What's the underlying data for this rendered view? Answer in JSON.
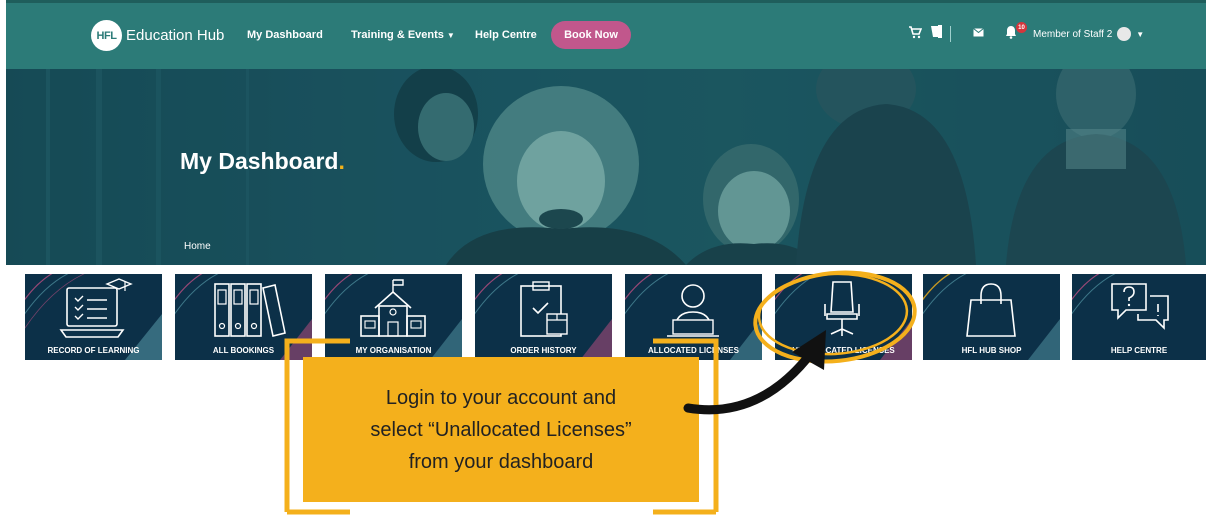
{
  "nav": {
    "logo_badge": "HFL",
    "logo_text": "Education Hub",
    "links": [
      {
        "label": "My Dashboard"
      },
      {
        "label": "Training & Events"
      },
      {
        "label": "Help Centre"
      }
    ],
    "book_now": "Book Now",
    "notification_count": "10",
    "user_name": "Member of Staff 2"
  },
  "hero": {
    "title": "My Dashboard",
    "title_dot": ".",
    "breadcrumb": "Home"
  },
  "tiles": [
    {
      "label": "RECORD OF LEARNING",
      "icon": "laptop-graduation-cap-icon"
    },
    {
      "label": "ALL BOOKINGS",
      "icon": "binders-icon"
    },
    {
      "label": "MY ORGANISATION",
      "icon": "school-building-icon"
    },
    {
      "label": "ORDER HISTORY",
      "icon": "clipboard-box-icon"
    },
    {
      "label": "ALLOCATED LICENSES",
      "icon": "person-laptop-icon"
    },
    {
      "label": "UNALLOCATED LICENSES",
      "icon": "office-chair-icon"
    },
    {
      "label": "HFL HUB SHOP",
      "icon": "shopping-bag-icon"
    },
    {
      "label": "HELP CENTRE",
      "icon": "question-chat-icon"
    }
  ],
  "annotation": {
    "lines": [
      "Login to your account and",
      "select “Unallocated Licenses”",
      "from your dashboard"
    ]
  },
  "colors": {
    "nav_bg": "#2c7b78",
    "book_button": "#c1578c",
    "accent_yellow": "#f2b21a",
    "tile_bg": "#0c3048"
  }
}
